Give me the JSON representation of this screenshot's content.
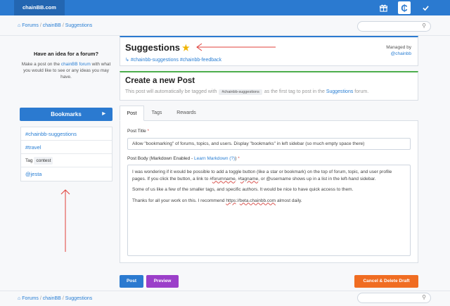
{
  "app": {
    "brand": "chainBB.com"
  },
  "topbar": {
    "gift_icon": "gift-icon",
    "coin_symbol": "₵",
    "check_icon": "check-icon"
  },
  "breadcrumb": {
    "items": [
      "Forums",
      "chainBB",
      "Suggestions"
    ],
    "separator": "/"
  },
  "sidebar": {
    "idea_title": "Have an idea for a forum?",
    "idea_text_before": "Make a post on the ",
    "idea_link": "chainBB forum",
    "idea_text_after": " with what you would like to see or any ideas you may have.",
    "bookmarks_label": "Bookmarks",
    "bookmarks": [
      {
        "label": "#chainbb-suggestions"
      },
      {
        "label": "#travel"
      },
      {
        "tag_label": "Tag",
        "tag_value": "contest"
      },
      {
        "label": "@jesta"
      }
    ]
  },
  "topic": {
    "title": "Suggestions",
    "tags": "#chainbb-suggestions #chainbb-feedback",
    "managed_by_label": "Managed by",
    "managed_by_user": "@chainbb"
  },
  "create": {
    "title": "Create a new Post",
    "sub_before": "This post will automatically be tagged with",
    "tag_chip": "#chainbb-suggestions",
    "sub_middle": "as the first tag to post in the",
    "forum_link": "Suggestions",
    "sub_after": "forum."
  },
  "tabs": [
    "Post",
    "Tags",
    "Rewards"
  ],
  "form": {
    "title_label": "Post Title",
    "title_value": "Allow \"bookmarking\" of forums, topics, and users. Display \"bookmarks\" in left sidebar (so much empty space there)",
    "body_label": "Post Body (Markdown Enabled - ",
    "body_link": "Learn Markdown (?)",
    "body_label_end": ")",
    "body_p1_a": "I was wondering if it would be possible to add a toggle button (like a star or bookmark) on the top of forum, topic, and user profile pages. If you click the button, a link to #",
    "body_p1_w1": "forumname",
    "body_p1_b": ", #",
    "body_p1_w2": "tagname",
    "body_p1_c": ", or @username shows up in a list in the left-hand sidebar.",
    "body_p2": "Some of us like a few of the smaller tags, and specific authors. It would be nice to have quick access to them.",
    "body_p3_a": "Thanks for all your work on this. I recommend ",
    "body_p3_w": "https",
    "body_p3_b": "://",
    "body_p3_w2": "beta.chainbb.com",
    "body_p3_c": " almost daily.",
    "required_mark": "*"
  },
  "buttons": {
    "post": "Post",
    "preview": "Preview",
    "cancel": "Cancel & Delete Draft"
  },
  "colors": {
    "primary": "#2b7ad0",
    "preview": "#9b3fc9",
    "cancel": "#f06d22",
    "annotation": "#e0403b"
  }
}
